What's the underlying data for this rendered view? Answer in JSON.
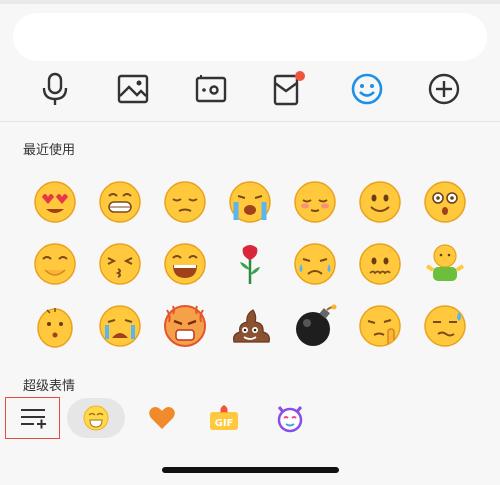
{
  "sections": {
    "recent_title": "最近使用",
    "super_title": "超级表情"
  },
  "toolbar": {
    "items": [
      {
        "name": "voice",
        "icon": "microphone-icon"
      },
      {
        "name": "image",
        "icon": "picture-icon"
      },
      {
        "name": "camera",
        "icon": "camera-icon"
      },
      {
        "name": "red-packet",
        "icon": "red-packet-icon",
        "badge": true
      },
      {
        "name": "emoji",
        "icon": "smile-icon",
        "active": true
      },
      {
        "name": "more",
        "icon": "plus-circle-icon"
      }
    ],
    "accent_color": "#1e90e8",
    "badge_color": "#f0553b"
  },
  "emoji_rows": [
    [
      "heart-eyes",
      "grin",
      "pensive",
      "loud-crying",
      "blushing",
      "smile",
      "shocked"
    ],
    [
      "giggle",
      "kiss",
      "laughing",
      "rose",
      "crying-sad",
      "worried",
      "shrug-figure"
    ],
    [
      "oh",
      "sobbing",
      "furious",
      "poop",
      "bomb",
      "picking-nose",
      "nervous-sweat"
    ]
  ],
  "bottom_tabs": [
    {
      "name": "manage",
      "icon": "list-add-icon",
      "highlighted_border": "#e74b3c"
    },
    {
      "name": "classic",
      "icon": "smiley-tab-icon",
      "selected": true
    },
    {
      "name": "favorites",
      "icon": "heart-icon",
      "color": "#f08a2a"
    },
    {
      "name": "gif",
      "icon": "gif-icon",
      "text": "GIF"
    },
    {
      "name": "character",
      "icon": "cat-face-icon",
      "color": "#8a4ee8"
    }
  ]
}
